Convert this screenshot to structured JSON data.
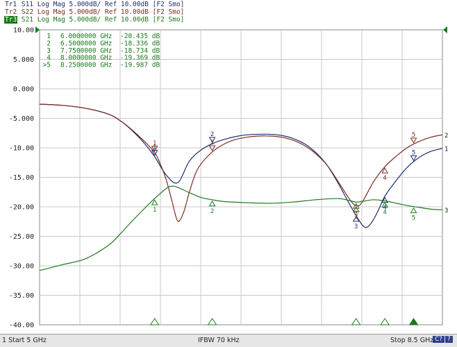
{
  "traces": [
    {
      "tag": "Tr1",
      "text": " S11 Log Mag 5.000dB/ Ref 10.00dB [F2 Smo]",
      "color": "#1f2a6e"
    },
    {
      "tag": "Tr2",
      "text": " S22 Log Mag 5.000dB/ Ref 10.00dB [F2 Smo]",
      "color": "#7a2b22"
    },
    {
      "tag": "Tr3",
      "text": " S21 Log Mag 5.000dB/ Ref 10.00dB [F2 Smo]",
      "color": "#1a7a1a"
    }
  ],
  "status": {
    "start": "1 Start 5 GHz",
    "ifbw": "IFBW 70 kHz",
    "stop": "Stop 8.5 GHz",
    "c_label": "C?",
    "q_label": "?"
  },
  "chart_data": {
    "type": "line",
    "xlim": [
      5,
      8.5
    ],
    "ylim": [
      -40,
      10
    ],
    "y_ticks": [
      10,
      5,
      0,
      -5,
      -10,
      -15,
      -20,
      -25,
      -30,
      -35,
      -40
    ],
    "y_tick_labels": [
      "10.00",
      "5.000",
      "0.000",
      "-5.000",
      "-10.00",
      "-15.00",
      "-20.00",
      "-25.00",
      "-30.00",
      "-35.00",
      "-40.00"
    ],
    "x_divisions": 10,
    "grid": true,
    "series": [
      {
        "name": "1",
        "color": "#1f2a6e",
        "x": [
          5.0,
          5.2,
          5.4,
          5.6,
          5.7,
          5.8,
          5.9,
          6.0,
          6.1,
          6.2,
          6.3,
          6.4,
          6.5,
          6.6,
          6.7,
          6.8,
          6.9,
          7.0,
          7.1,
          7.2,
          7.3,
          7.4,
          7.5,
          7.6,
          7.7,
          7.8,
          7.85,
          7.9,
          7.95,
          8.0,
          8.1,
          8.2,
          8.3,
          8.4,
          8.5
        ],
        "values": [
          -2.6,
          -2.8,
          -3.3,
          -4.3,
          -5.4,
          -7.0,
          -9.0,
          -11.5,
          -14.6,
          -15.9,
          -12.3,
          -10.4,
          -9.3,
          -8.6,
          -8.1,
          -7.8,
          -7.7,
          -7.7,
          -7.9,
          -8.4,
          -9.3,
          -10.8,
          -13.0,
          -16.2,
          -19.8,
          -23.0,
          -23.4,
          -22.2,
          -20.3,
          -18.2,
          -15.5,
          -13.2,
          -11.6,
          -10.6,
          -10.1
        ]
      },
      {
        "name": "2",
        "color": "#7a2b22",
        "x": [
          5.0,
          5.2,
          5.4,
          5.6,
          5.7,
          5.8,
          5.9,
          6.0,
          6.05,
          6.1,
          6.15,
          6.2,
          6.25,
          6.3,
          6.35,
          6.4,
          6.5,
          6.6,
          6.7,
          6.8,
          6.9,
          7.0,
          7.1,
          7.2,
          7.3,
          7.4,
          7.5,
          7.6,
          7.7,
          7.75,
          7.8,
          7.9,
          8.0,
          8.1,
          8.2,
          8.3,
          8.4,
          8.5
        ],
        "values": [
          -2.6,
          -2.8,
          -3.3,
          -4.3,
          -5.4,
          -6.9,
          -8.7,
          -10.8,
          -12.8,
          -15.4,
          -19.0,
          -22.4,
          -21.0,
          -17.6,
          -14.6,
          -12.8,
          -10.7,
          -9.4,
          -8.6,
          -8.2,
          -8.0,
          -8.0,
          -8.2,
          -8.7,
          -9.6,
          -11.0,
          -13.0,
          -15.9,
          -18.9,
          -19.8,
          -19.3,
          -15.8,
          -13.2,
          -11.4,
          -9.9,
          -8.9,
          -8.2,
          -7.8
        ]
      },
      {
        "name": "3",
        "color": "#1a7a1a",
        "x": [
          5.0,
          5.2,
          5.4,
          5.6,
          5.7,
          5.8,
          5.9,
          6.0,
          6.1,
          6.15,
          6.2,
          6.3,
          6.4,
          6.5,
          6.6,
          6.8,
          7.0,
          7.2,
          7.4,
          7.6,
          7.7,
          7.75,
          7.8,
          7.9,
          8.0,
          8.1,
          8.2,
          8.3,
          8.4,
          8.5
        ],
        "values": [
          -30.8,
          -29.8,
          -28.8,
          -26.5,
          -24.6,
          -22.5,
          -20.5,
          -18.6,
          -16.9,
          -16.5,
          -16.7,
          -17.6,
          -18.4,
          -18.8,
          -19.1,
          -19.3,
          -19.4,
          -19.2,
          -18.8,
          -18.6,
          -19.0,
          -19.2,
          -19.1,
          -18.8,
          -19.0,
          -19.4,
          -19.8,
          -20.1,
          -20.4,
          -20.5
        ]
      }
    ],
    "marker_table": [
      {
        "label": "1",
        "freq": "6.0000000 GHz",
        "value": "-20.435 dB"
      },
      {
        "label": "2",
        "freq": "6.5000000 GHz",
        "value": "-18.336 dB"
      },
      {
        "label": "3",
        "freq": "7.7500000 GHz",
        "value": "-18.734 dB"
      },
      {
        "label": "4",
        "freq": "8.0000000 GHz",
        "value": "-19.369 dB"
      },
      {
        "label": ">5",
        "freq": "8.2500000 GHz",
        "value": "-19.987 dB"
      }
    ],
    "markers": [
      {
        "label": "1",
        "x": 6.0
      },
      {
        "label": "2",
        "x": 6.5
      },
      {
        "label": "3",
        "x": 7.75
      },
      {
        "label": "4",
        "x": 8.0
      },
      {
        "label": "5",
        "x": 8.25
      }
    ],
    "ref_marker_value": 10,
    "active_marker": "5"
  }
}
